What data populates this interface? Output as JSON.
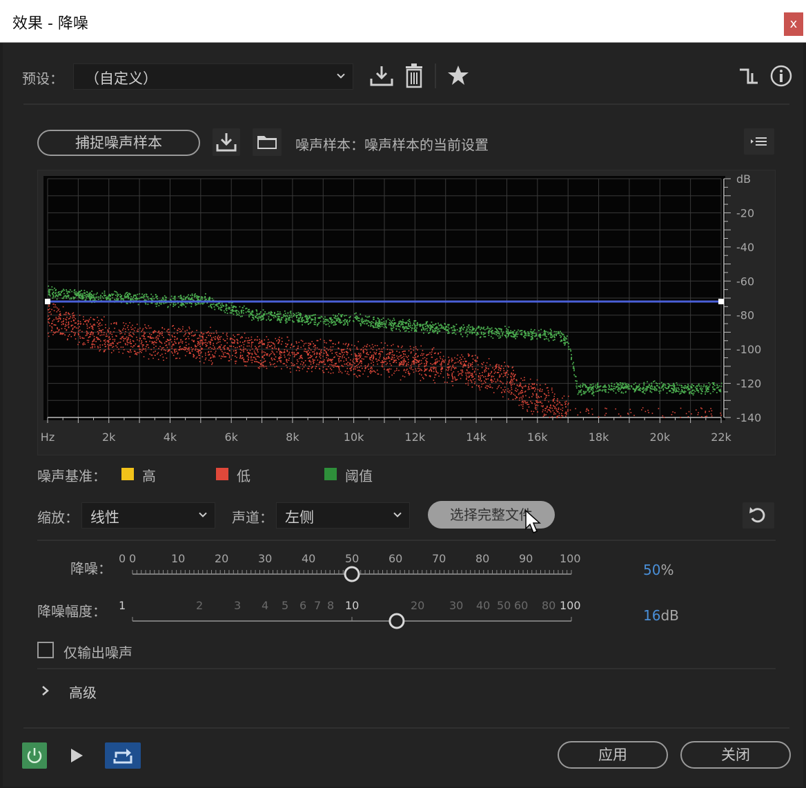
{
  "window": {
    "title": "效果 - 降噪",
    "close_symbol": "x"
  },
  "preset": {
    "label": "预设：",
    "value": "（自定义）"
  },
  "capture": {
    "button_label": "捕捉噪声样本",
    "noise_sample_text": "噪声样本：噪声样本的当前设置"
  },
  "chart_data": {
    "type": "scatter",
    "title": "",
    "x": {
      "label": "Hz",
      "tick_labels": [
        "Hz",
        "2k",
        "4k",
        "6k",
        "8k",
        "10k",
        "12k",
        "14k",
        "16k",
        "18k",
        "20k",
        "22k"
      ],
      "range": [
        0,
        22000
      ]
    },
    "y": {
      "unit_label": "dB",
      "tick_labels": [
        "-20",
        "-40",
        "-60",
        "-80",
        "-100",
        "-120",
        "-140"
      ],
      "range": [
        -140,
        0
      ]
    },
    "threshold_line_db": -72,
    "series": [
      {
        "name": "阈值",
        "color": "#4caf50",
        "x": [
          0,
          1000,
          2000,
          3000,
          4000,
          5000,
          6000,
          7000,
          8000,
          9000,
          10000,
          11000,
          12000,
          13000,
          14000,
          15000,
          16000,
          16800,
          17000,
          17300,
          18000,
          19000,
          20000,
          21000,
          22000
        ],
        "y": [
          -66,
          -68,
          -69,
          -70,
          -72,
          -70,
          -76,
          -80,
          -81,
          -83,
          -82,
          -85,
          -86,
          -88,
          -89,
          -90,
          -91,
          -92,
          -97,
          -123,
          -123,
          -122,
          -122,
          -123,
          -122
        ]
      },
      {
        "name": "低",
        "color": "#e0483a",
        "x": [
          0,
          1000,
          2000,
          3000,
          4000,
          5000,
          6000,
          7000,
          8000,
          9000,
          10000,
          11000,
          12000,
          13000,
          14000,
          15000,
          15500,
          16000,
          16500,
          17000
        ],
        "y": [
          -82,
          -88,
          -92,
          -95,
          -96,
          -97,
          -99,
          -101,
          -103,
          -104,
          -106,
          -106,
          -108,
          -110,
          -113,
          -118,
          -125,
          -128,
          -132,
          -137
        ]
      }
    ]
  },
  "legend": {
    "label": "噪声基准：",
    "items": [
      {
        "label": "高",
        "color": "#f2c21a"
      },
      {
        "label": "低",
        "color": "#e0483a"
      },
      {
        "label": "阈值",
        "color": "#2e8f3a"
      }
    ]
  },
  "zoom": {
    "label": "缩放：",
    "value": "线性"
  },
  "channel": {
    "label": "声道：",
    "value": "左侧"
  },
  "select_file_button": "选择完整文件",
  "reduction": {
    "label": "降噪：",
    "ticks": [
      "0",
      "0",
      "10",
      "20",
      "30",
      "40",
      "50",
      "60",
      "70",
      "80",
      "90",
      "100"
    ],
    "value_percent": 50,
    "value_text": "50",
    "unit": "%"
  },
  "reduce_by": {
    "label": "降噪幅度：",
    "ticks": [
      "1",
      "2",
      "3",
      "4",
      "5",
      "6",
      "7",
      "8",
      "10",
      "20",
      "30",
      "40",
      "50",
      "60",
      "80",
      "100"
    ],
    "value_db": 16,
    "value_text": "16",
    "unit": "dB"
  },
  "output_noise_only": {
    "label": "仅输出噪声",
    "checked": false
  },
  "advanced": {
    "label": "高级"
  },
  "footer": {
    "apply": "应用",
    "close": "关闭"
  }
}
